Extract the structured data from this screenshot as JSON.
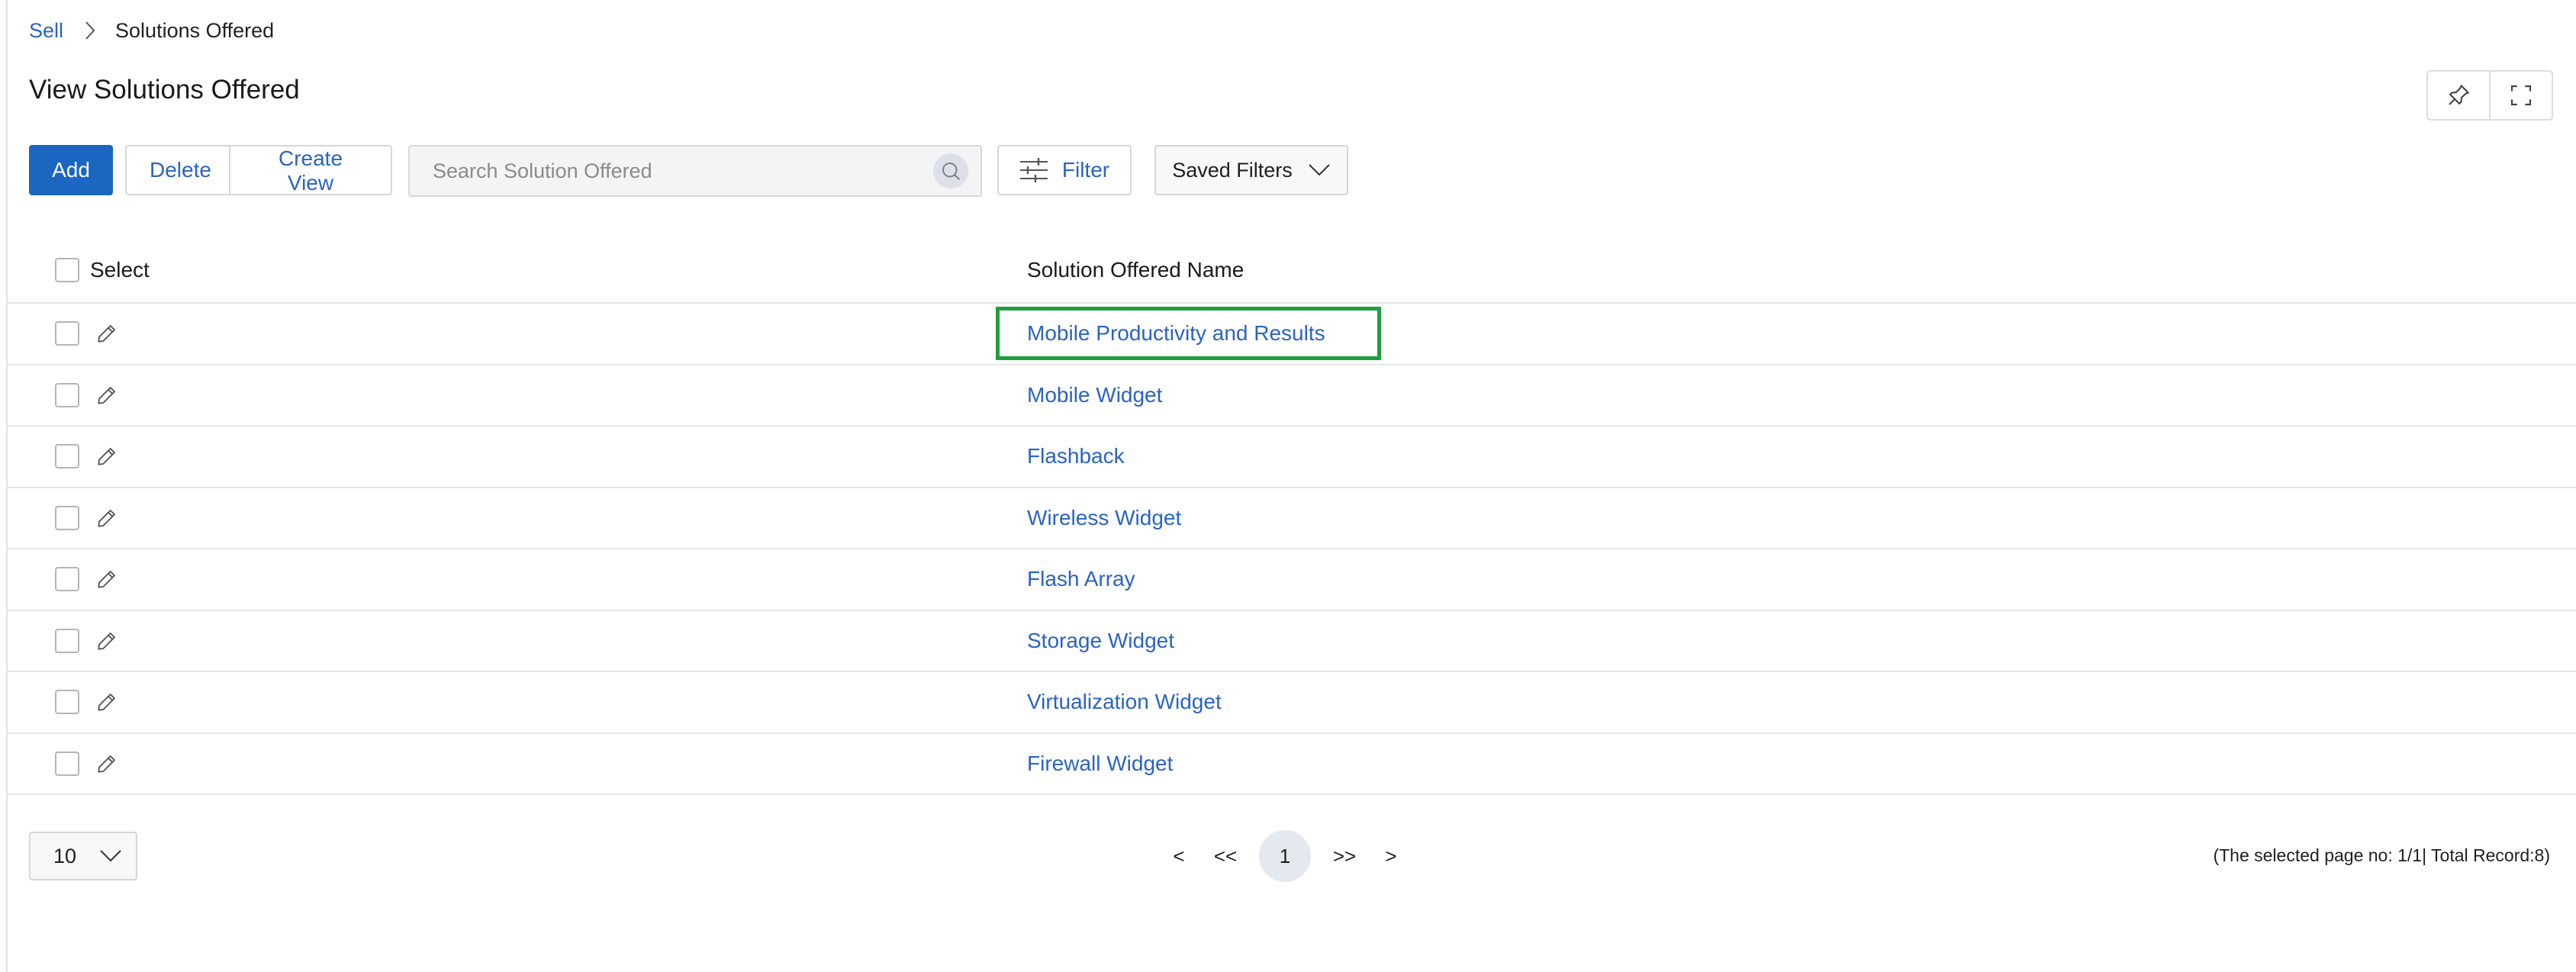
{
  "breadcrumb": {
    "parent": "Sell",
    "current": "Solutions Offered"
  },
  "page": {
    "title": "View Solutions Offered"
  },
  "toolbar": {
    "add_label": "Add",
    "delete_label": "Delete",
    "create_view_label": "Create View",
    "search_placeholder": "Search Solution Offered",
    "filter_label": "Filter",
    "saved_filters_label": "Saved Filters"
  },
  "table": {
    "columns": {
      "select": "Select",
      "name": "Solution Offered Name"
    },
    "rows": [
      {
        "name": "Mobile Productivity and Results"
      },
      {
        "name": "Mobile Widget"
      },
      {
        "name": "Flashback"
      },
      {
        "name": "Wireless Widget"
      },
      {
        "name": "Flash Array"
      },
      {
        "name": "Storage Widget"
      },
      {
        "name": "Virtualization Widget"
      },
      {
        "name": "Firewall Widget"
      }
    ]
  },
  "footer": {
    "page_size": "10",
    "prev": "<",
    "first": "<<",
    "current_page": "1",
    "last": ">>",
    "next": ">",
    "records_text": "(The selected page no: 1/1| Total Record:8)"
  },
  "colors": {
    "accent": "#1a66c0",
    "link": "#2a63c4",
    "highlight": "#1f9e3e"
  },
  "icons": [
    "chevron-right-icon",
    "pin-icon",
    "fullscreen-icon",
    "search-icon",
    "filter-sliders-icon",
    "chevron-down-icon",
    "pencil-icon"
  ]
}
